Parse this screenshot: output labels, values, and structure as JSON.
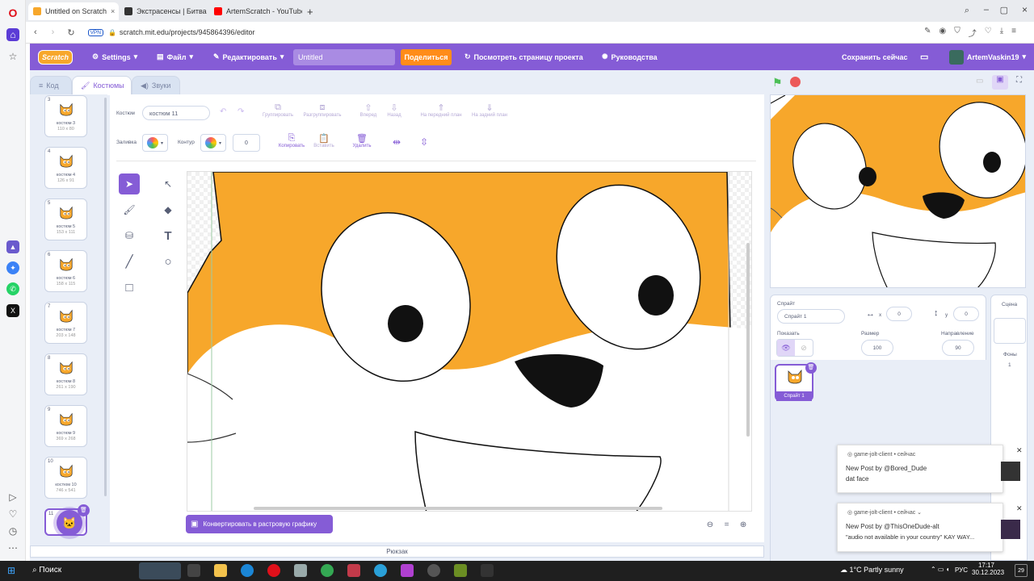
{
  "browser": {
    "tabs": [
      {
        "label": "Untitled on Scratch",
        "color": "#f7a72b"
      },
      {
        "label": "Экстрасенсы | Битва сил...",
        "color": "#333333"
      },
      {
        "label": "ArtemScratch - YouTube",
        "color": "#ff0000"
      }
    ],
    "new_tab": "+",
    "url": "scratch.mit.edu/projects/945864396/editor",
    "vpn": "VPN"
  },
  "menu": {
    "logo": "Scratch",
    "settings": "Settings",
    "file": "Файл",
    "edit": "Редактировать",
    "project_title": "Untitled",
    "share": "Поделиться",
    "see_project": "Посмотреть страницу проекта",
    "tutorials": "Руководства",
    "save_now": "Сохранить сейчас",
    "username": "ArtemVaskin19"
  },
  "editor_tabs": {
    "code": "Код",
    "costumes": "Костюмы",
    "sounds": "Звуки"
  },
  "costumes": [
    {
      "num": "3",
      "name": "костюм 3",
      "size": "110 x 80"
    },
    {
      "num": "4",
      "name": "костюм 4",
      "size": "126 x 91"
    },
    {
      "num": "5",
      "name": "костюм 5",
      "size": "153 x 111"
    },
    {
      "num": "6",
      "name": "костюм 6",
      "size": "158 x 115"
    },
    {
      "num": "7",
      "name": "костюм 7",
      "size": "203 x 148"
    },
    {
      "num": "8",
      "name": "костюм 8",
      "size": "261 x 190"
    },
    {
      "num": "9",
      "name": "костюм 9",
      "size": "369 x 268"
    },
    {
      "num": "10",
      "name": "костюм 10",
      "size": "746 x 541"
    },
    {
      "num": "11",
      "name": "",
      "size": ""
    }
  ],
  "paint": {
    "costume_label": "Костюм",
    "costume_name": "костюм 11",
    "group": "Группировать",
    "ungroup": "Разгруппировать",
    "forward": "Вперед",
    "backward": "Назад",
    "front": "На передний план",
    "back": "На задний план",
    "fill_label": "Заливка",
    "outline_label": "Контур",
    "outline_value": "0",
    "copy": "Копировать",
    "paste": "Вставить",
    "delete": "Удалить",
    "convert": "Конвертировать в растровую графику",
    "zoom_reset": "="
  },
  "sprite": {
    "label": "Спрайт",
    "name": "Спрайт 1",
    "x_label": "x",
    "x": "0",
    "y_label": "y",
    "y": "0",
    "show_label": "Показать",
    "size_label": "Размер",
    "size": "100",
    "direction_label": "Направление",
    "direction": "90",
    "thumb_name": "Спрайт 1"
  },
  "stage_panel": {
    "label": "Сцена",
    "backdrops_label": "Фоны",
    "backdrops_count": "1"
  },
  "backpack": "Рюкзак",
  "notifications": [
    {
      "app": "game-jolt-client",
      "time": "сейчас",
      "title": "New Post by @Bored_Dude",
      "body": "dat face"
    },
    {
      "app": "game-jolt-client",
      "time": "сейчас",
      "title": "New Post by @ThisOneDude-alt",
      "body": "\"audio not available in your country\" KAY WAY..."
    }
  ],
  "taskbar": {
    "search": "Поиск",
    "weather": "1°C  Partly sunny",
    "lang": "РУС",
    "time": "17:17",
    "date": "30.12.2023",
    "notif_count": "29"
  },
  "colors": {
    "scratch_purple": "#855cd6",
    "share_orange": "#ff8c1a",
    "cat_orange": "#f7a72b",
    "stage_green": "#4cbf56",
    "stop_red": "#ec5959"
  }
}
